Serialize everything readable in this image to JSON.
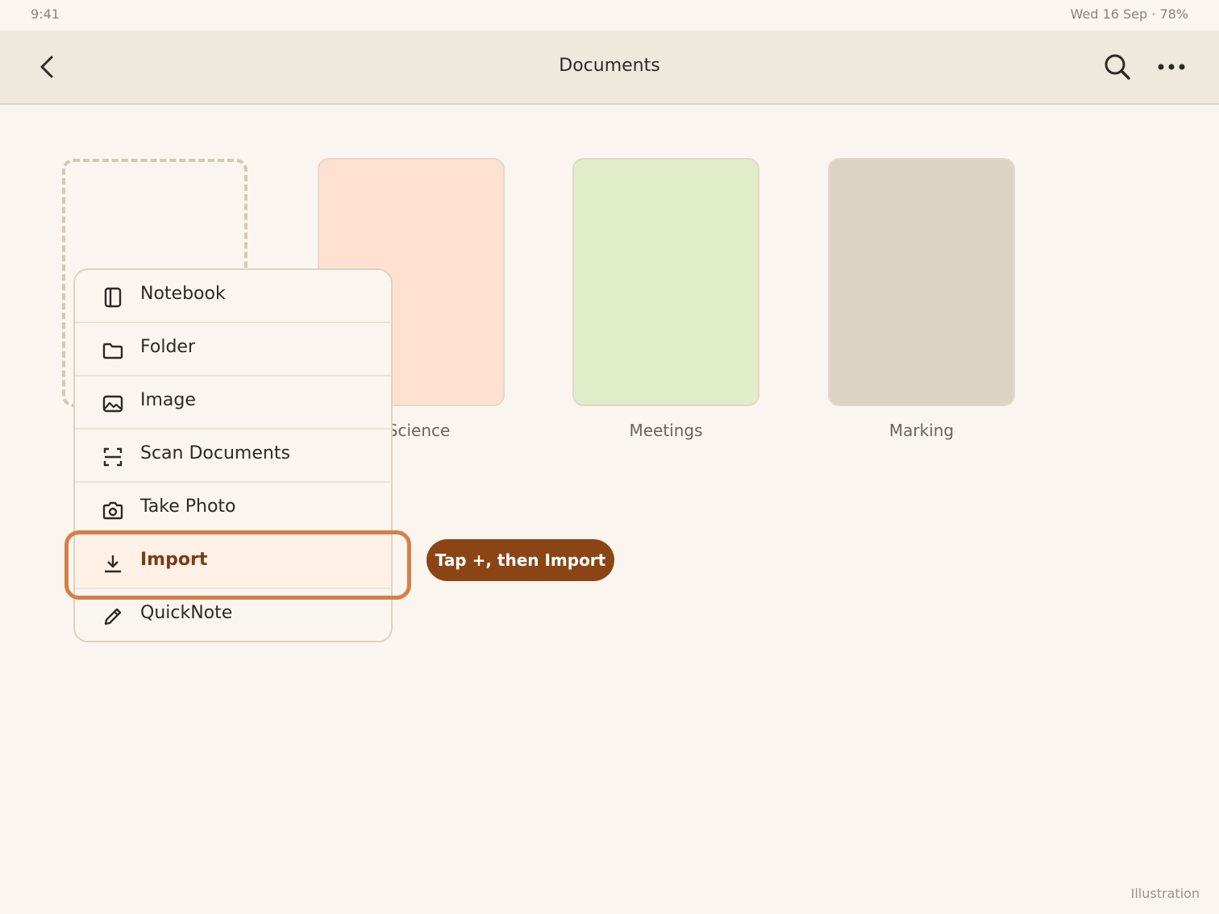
{
  "status_bar": {
    "time": "9:41",
    "right": "Wed 16 Sep · 78%"
  },
  "nav": {
    "title": "Documents",
    "back_icon": "chevron-left-icon",
    "search_icon": "search-icon",
    "more_icon": "more-horizontal-icon"
  },
  "tiles": [
    {
      "label": "9 Science",
      "color": "#ffe1d2"
    },
    {
      "label": "Meetings",
      "color": "#e1edc9"
    },
    {
      "label": "Marking",
      "color": "#ddd3c4"
    }
  ],
  "menu": {
    "items": [
      {
        "label": "Notebook",
        "icon": "notebook-icon"
      },
      {
        "label": "Folder",
        "icon": "folder-icon"
      },
      {
        "label": "Image",
        "icon": "image-icon"
      },
      {
        "label": "Scan Documents",
        "icon": "scan-icon"
      },
      {
        "label": "Take Photo",
        "icon": "camera-icon"
      },
      {
        "label": "Import",
        "icon": "download-icon"
      },
      {
        "label": "QuickNote",
        "icon": "pencil-icon"
      }
    ],
    "selected": "Import"
  },
  "hint": {
    "text": "Tap +, then Import"
  },
  "footer_note": "Illustration",
  "colors": {
    "accent": "#8b4515",
    "highlight": "#d57f48",
    "background": "#faf5ee"
  }
}
